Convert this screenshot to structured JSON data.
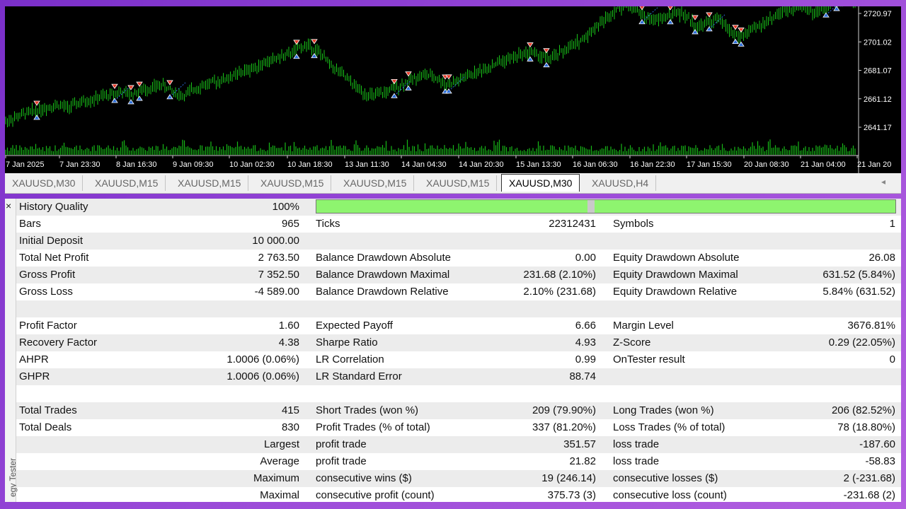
{
  "chart": {
    "price_labels": [
      "2720.97",
      "2701.02",
      "2681.07",
      "2661.12",
      "2641.17"
    ],
    "date_labels": [
      "7 Jan 2025",
      "7 Jan 23:30",
      "8 Jan 16:30",
      "9 Jan 09:30",
      "10 Jan 02:30",
      "10 Jan 18:30",
      "13 Jan 11:30",
      "14 Jan 04:30",
      "14 Jan 20:30",
      "15 Jan 13:30",
      "16 Jan 06:30",
      "16 Jan 22:30",
      "17 Jan 15:30",
      "20 Jan 08:30",
      "21 Jan 04:00",
      "21 Jan 20"
    ],
    "colors": {
      "background": "#000000",
      "bars": "#19c519",
      "volume": "#17b917",
      "sell_marker": "#e53b2a",
      "buy_marker": "#2b6cd8",
      "axis_text": "#ffffff"
    },
    "price_path": [
      2645,
      2648,
      2651,
      2653,
      2655,
      2657,
      2655,
      2658,
      2660,
      2662,
      2664,
      2666,
      2664,
      2667,
      2669,
      2671,
      2666,
      2663,
      2668,
      2671,
      2673,
      2675,
      2678,
      2681,
      2684,
      2687,
      2690,
      2692,
      2697,
      2699,
      2693,
      2685,
      2679,
      2672,
      2666,
      2663,
      2665,
      2668,
      2672,
      2676,
      2678,
      2676,
      2671,
      2673,
      2677,
      2680,
      2683,
      2687,
      2689,
      2692,
      2694,
      2691,
      2689,
      2694,
      2698,
      2703,
      2710,
      2716,
      2723,
      2727,
      2724,
      2718,
      2716,
      2719,
      2722,
      2718,
      2711,
      2715,
      2717,
      2709,
      2704,
      2709,
      2713,
      2718,
      2722,
      2725,
      2727,
      2721,
      2724,
      2729,
      2731,
      2730
    ]
  },
  "tabs": [
    {
      "label": "XAUUSD,M30",
      "active": false
    },
    {
      "label": "XAUUSD,M15",
      "active": false
    },
    {
      "label": "XAUUSD,M15",
      "active": false
    },
    {
      "label": "XAUUSD,M15",
      "active": false
    },
    {
      "label": "XAUUSD,M15",
      "active": false
    },
    {
      "label": "XAUUSD,M15",
      "active": false
    },
    {
      "label": "XAUUSD,M30",
      "active": true
    },
    {
      "label": "XAUUSD,H4",
      "active": false
    }
  ],
  "side_panel": {
    "close_glyph": "×",
    "label": "egy Tester"
  },
  "history_quality": {
    "label": "History Quality",
    "value": "100%",
    "percent": 100
  },
  "rows": [
    {
      "l1": "Bars",
      "v1": "965",
      "l2": "Ticks",
      "v2": "22312431",
      "l3": "Symbols",
      "v3": "1"
    },
    {
      "l1": "Initial Deposit",
      "v1": "10 000.00",
      "l2": "",
      "v2": "",
      "l3": "",
      "v3": ""
    },
    {
      "l1": "Total Net Profit",
      "v1": "2 763.50",
      "l2": "Balance Drawdown Absolute",
      "v2": "0.00",
      "l3": "Equity Drawdown Absolute",
      "v3": "26.08"
    },
    {
      "l1": "Gross Profit",
      "v1": "7 352.50",
      "l2": "Balance Drawdown Maximal",
      "v2": "231.68 (2.10%)",
      "l3": "Equity Drawdown Maximal",
      "v3": "631.52 (5.84%)"
    },
    {
      "l1": "Gross Loss",
      "v1": "-4 589.00",
      "l2": "Balance Drawdown Relative",
      "v2": "2.10% (231.68)",
      "l3": "Equity Drawdown Relative",
      "v3": "5.84% (631.52)"
    },
    {
      "l1": "",
      "v1": "",
      "l2": "",
      "v2": "",
      "l3": "",
      "v3": ""
    },
    {
      "l1": "Profit Factor",
      "v1": "1.60",
      "l2": "Expected Payoff",
      "v2": "6.66",
      "l3": "Margin Level",
      "v3": "3676.81%"
    },
    {
      "l1": "Recovery Factor",
      "v1": "4.38",
      "l2": "Sharpe Ratio",
      "v2": "4.93",
      "l3": "Z-Score",
      "v3": "0.29 (22.05%)"
    },
    {
      "l1": "AHPR",
      "v1": "1.0006 (0.06%)",
      "l2": "LR Correlation",
      "v2": "0.99",
      "l3": "OnTester result",
      "v3": "0"
    },
    {
      "l1": "GHPR",
      "v1": "1.0006 (0.06%)",
      "l2": "LR Standard Error",
      "v2": "88.74",
      "l3": "",
      "v3": ""
    },
    {
      "l1": "",
      "v1": "",
      "l2": "",
      "v2": "",
      "l3": "",
      "v3": ""
    },
    {
      "l1": "Total Trades",
      "v1": "415",
      "l2": "Short Trades (won %)",
      "v2": "209 (79.90%)",
      "l3": "Long Trades (won %)",
      "v3": "206 (82.52%)"
    },
    {
      "l1": "Total Deals",
      "v1": "830",
      "l2": "Profit Trades (% of total)",
      "v2": "337 (81.20%)",
      "l3": "Loss Trades (% of total)",
      "v3": "78 (18.80%)"
    },
    {
      "l1": "",
      "v1": "Largest",
      "l2": "profit trade",
      "v2": "351.57",
      "l3": "loss trade",
      "v3": "-187.60"
    },
    {
      "l1": "",
      "v1": "Average",
      "l2": "profit trade",
      "v2": "21.82",
      "l3": "loss trade",
      "v3": "-58.83"
    },
    {
      "l1": "",
      "v1": "Maximum",
      "l2": "consecutive wins ($)",
      "v2": "19 (246.14)",
      "l3": "consecutive losses ($)",
      "v3": "2 (-231.68)"
    },
    {
      "l1": "",
      "v1": "Maximal",
      "l2": "consecutive profit (count)",
      "v2": "375.73 (3)",
      "l3": "consecutive loss (count)",
      "v3": "-231.68 (2)"
    }
  ]
}
